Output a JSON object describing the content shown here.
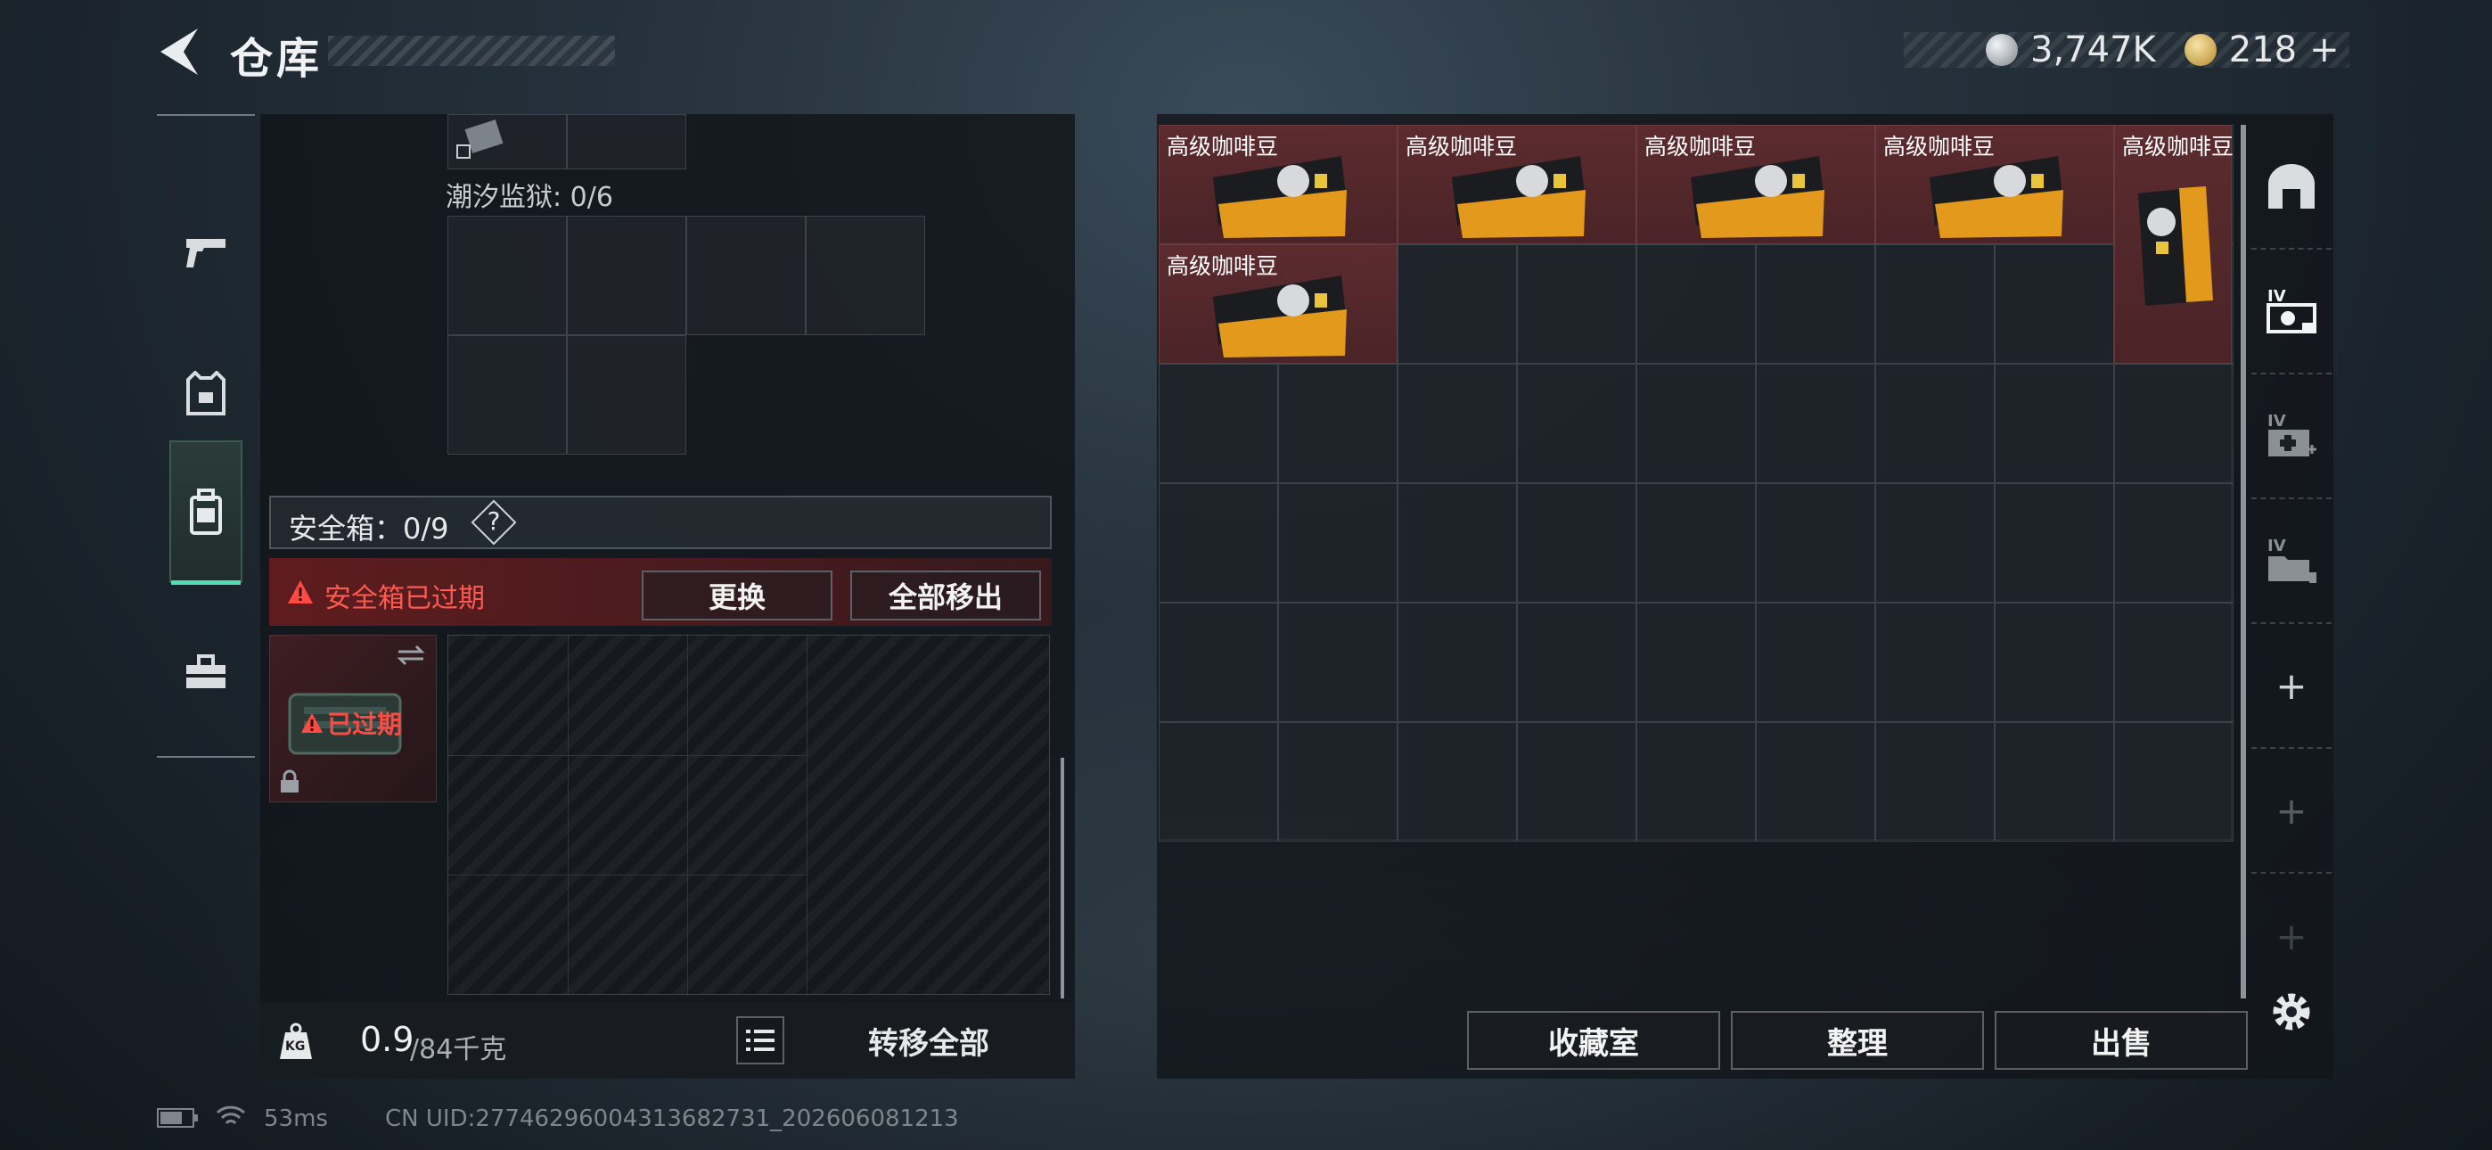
{
  "header": {
    "title": "仓库"
  },
  "currency": [
    {
      "icon": "silver-coin-icon",
      "value": "3,747K",
      "color": "#c9ced3"
    },
    {
      "icon": "gold-coin-icon",
      "value": "218",
      "color": "#d9b45a"
    }
  ],
  "currency_add_label": "+",
  "tabs": [
    {
      "name": "weapons",
      "icon": "pistol-icon"
    },
    {
      "name": "armor",
      "icon": "vest-icon"
    },
    {
      "name": "backpack",
      "icon": "backpack-icon",
      "active": true
    },
    {
      "name": "supplies",
      "icon": "toolbox-icon"
    }
  ],
  "loadout": {
    "prison_label": "潮汐监狱: 0/6",
    "safe_label": "安全箱：0/9",
    "help_label": "?",
    "expired_warning": "安全箱已过期",
    "replace_label": "更换",
    "remove_all_label": "全部移出",
    "case_status": "已过期",
    "weight_value": "0.9",
    "weight_max": "/84千克",
    "weight_unit_icon": "KG",
    "transfer_all_label": "转移全部"
  },
  "stash": {
    "items": [
      {
        "label": "高级咖啡豆"
      },
      {
        "label": "高级咖啡豆"
      },
      {
        "label": "高级咖啡豆"
      },
      {
        "label": "高级咖啡豆"
      },
      {
        "label": "高级咖啡豆"
      },
      {
        "label": "高级咖啡豆"
      }
    ],
    "collection_label": "收藏室",
    "sort_label": "整理",
    "sell_label": "出售",
    "side_add_label": "+",
    "side_tier_label": "IV"
  },
  "status": {
    "ping": "53ms",
    "uid": "CN UID:27746296004313682731_202606081213"
  },
  "colors": {
    "accent": "#4fe0b0",
    "warning": "#e0433e",
    "item_bg": "#5c2b2e"
  }
}
